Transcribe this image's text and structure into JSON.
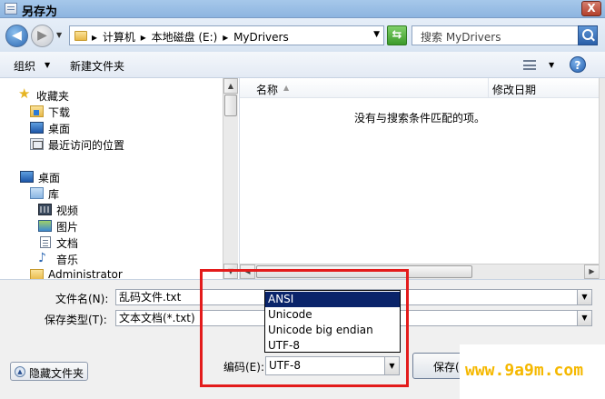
{
  "window": {
    "title": "另存为",
    "close_label": "X"
  },
  "address_bar": {
    "segments": [
      "计算机",
      "本地磁盘 (E:)",
      "MyDrivers"
    ],
    "separator": "▸",
    "search_placeholder": "搜索 MyDrivers"
  },
  "toolbar": {
    "organize_label": "组织",
    "new_folder_label": "新建文件夹",
    "help_label": "?"
  },
  "nav_pane": {
    "favorites_label": "收藏夹",
    "favorites_items": [
      "下载",
      "桌面",
      "最近访问的位置"
    ],
    "desktop_label": "桌面",
    "libraries_label": "库",
    "library_items": [
      "视频",
      "图片",
      "文档",
      "音乐"
    ],
    "user_label": "Administrator"
  },
  "file_list": {
    "columns": {
      "name": "名称",
      "date_modified": "修改日期"
    },
    "empty_message": "没有与搜索条件匹配的项。"
  },
  "form": {
    "filename_label": "文件名(N):",
    "filename_value": "乱码文件.txt",
    "save_type_label": "保存类型(T):",
    "save_type_value": "文本文档(*.txt)",
    "hide_folders_label": "隐藏文件夹",
    "encoding_label": "编码(E):",
    "encoding_value": "UTF-8",
    "save_button_label": "保存(S)"
  },
  "encoding_options": [
    {
      "label": "ANSI",
      "selected": true
    },
    {
      "label": "Unicode",
      "selected": false
    },
    {
      "label": "Unicode big endian",
      "selected": false
    },
    {
      "label": "UTF-8",
      "selected": false
    }
  ],
  "watermark": "www.9a9m.com",
  "colors": {
    "highlight": "#e31b1b",
    "selection": "#0a246a",
    "watermark": "#f5b800"
  }
}
